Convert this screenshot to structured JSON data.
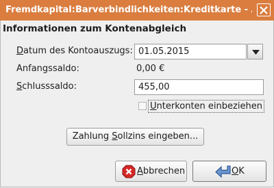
{
  "window": {
    "title": "Fremdkapital:Barverbindlichkeiten:Kreditkarte - Abgleich",
    "close_icon": "close-icon"
  },
  "form": {
    "heading": "Informationen zum Kontenabgleich",
    "datum_label_mnemonic": "D",
    "datum_label_rest": "atum des Kontoauszugs:",
    "datum_value": "01.05.2015",
    "anfangssaldo_label": "Anfangssaldo:",
    "anfangssaldo_value": "0,00 €",
    "schlusssaldo_label_mnemonic": "S",
    "schlusssaldo_label_rest": "chlusssaldo:",
    "schlusssaldo_value": "455,00",
    "unterkonten_label_mnemonic": "U",
    "unterkonten_label_rest": "nterkonten einbeziehen",
    "unterkonten_checked": false
  },
  "buttons": {
    "zahlung_pre": "Zahlung ",
    "zahlung_mnemonic": "S",
    "zahlung_post": "ollzins eingeben...",
    "abbrechen_mnemonic": "A",
    "abbrechen_rest": "bbrechen",
    "ok_mnemonic": "O",
    "ok_rest": "K"
  },
  "colors": {
    "titlebar": "#da7d3f",
    "background": "#efefef",
    "cancel_icon": "#d62828",
    "ok_icon": "#3465a4"
  }
}
